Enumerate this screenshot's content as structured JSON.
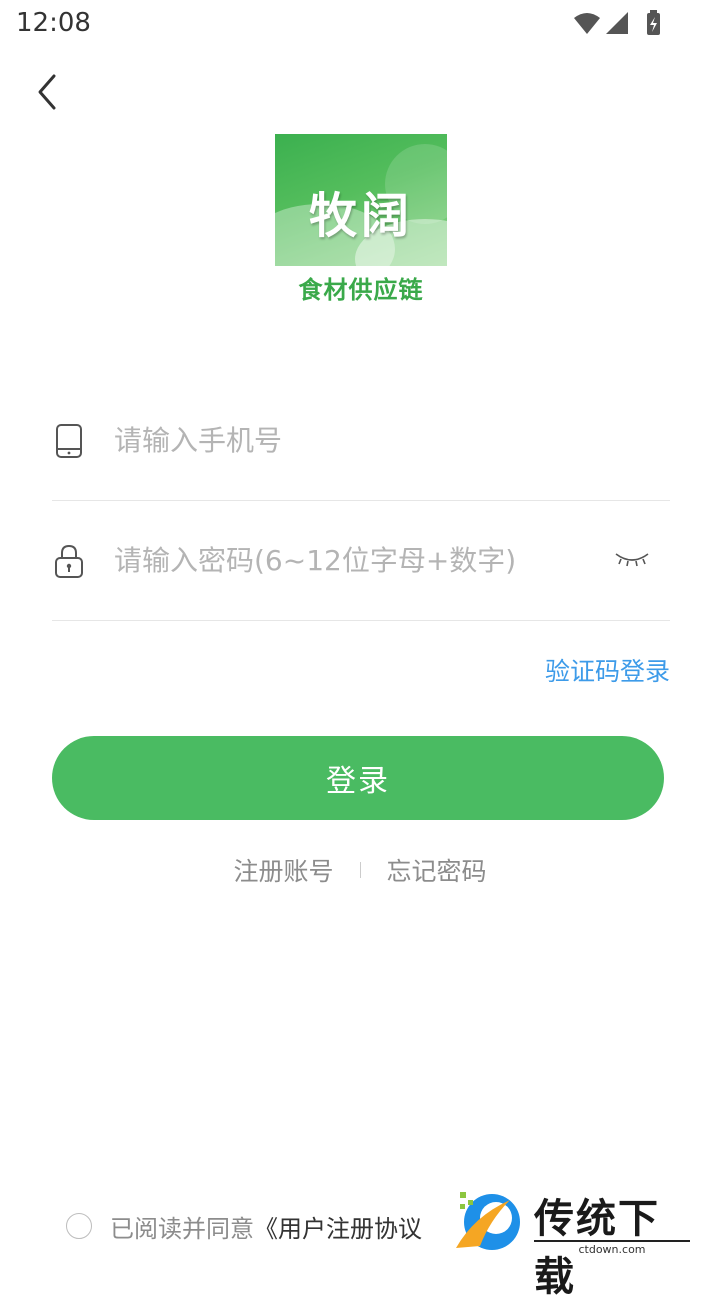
{
  "status_bar": {
    "time": "12:08"
  },
  "logo": {
    "main_text": "牧阔",
    "sub_text": "食材供应链"
  },
  "form": {
    "phone_placeholder": "请输入手机号",
    "password_placeholder": "请输入密码(6~12位字母+数字)"
  },
  "sms_login_label": "验证码登录",
  "login_label": "登录",
  "links": {
    "register": "注册账号",
    "forgot": "忘记密码"
  },
  "agreement": {
    "prefix": "已阅读并同意",
    "link": "《用户注册协议"
  },
  "watermark": {
    "title": "传统下载",
    "subtitle": "ctdown.com"
  },
  "colors": {
    "primary_green": "#4abb62",
    "link_blue": "#3d9be9"
  }
}
